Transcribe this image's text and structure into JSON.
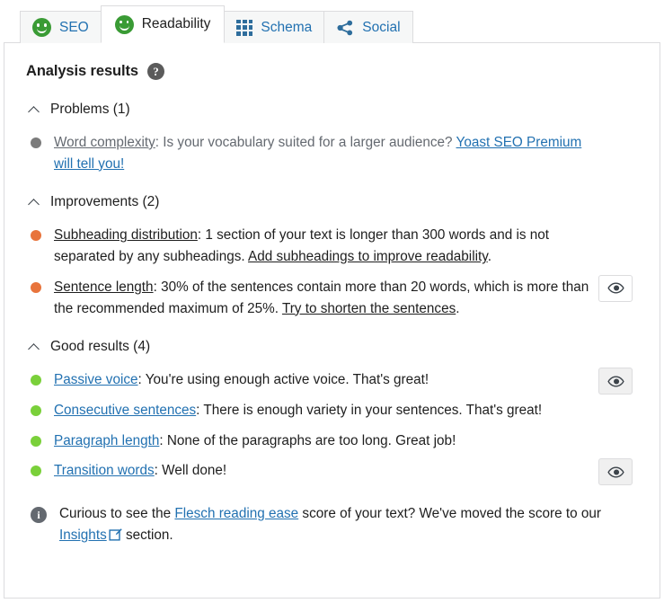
{
  "tabs": [
    {
      "id": "seo",
      "label": "SEO",
      "icon": "smiley-green-icon",
      "active": false
    },
    {
      "id": "readability",
      "label": "Readability",
      "icon": "smiley-green-icon",
      "active": true
    },
    {
      "id": "schema",
      "label": "Schema",
      "icon": "grid-icon",
      "active": false
    },
    {
      "id": "social",
      "label": "Social",
      "icon": "share-icon",
      "active": false
    }
  ],
  "analysis": {
    "title": "Analysis results",
    "help_icon": "question-mark-icon"
  },
  "sections": [
    {
      "id": "problems",
      "title": "Problems (1)",
      "chevron": "chevron-up-icon",
      "items": [
        {
          "id": "word-complexity",
          "bullet_color": "#7b7b7b",
          "state": "muted",
          "title": "Word complexity",
          "body": ": Is your vocabulary suited for a larger audience? ",
          "link_text": "Yoast SEO Premium will tell you!",
          "link_style": "blue",
          "tail": "",
          "eye_button": false
        }
      ]
    },
    {
      "id": "improvements",
      "title": "Improvements (2)",
      "chevron": "chevron-up-icon",
      "items": [
        {
          "id": "subheading-distribution",
          "bullet_color": "#e8743c",
          "state": "improvement",
          "title": "Subheading distribution",
          "body": ": 1 section of your text is longer than 300 words and is not separated by any subheadings. ",
          "link_text": "Add subheadings to improve readability",
          "link_style": "dark",
          "tail": ".",
          "eye_button": false
        },
        {
          "id": "sentence-length",
          "bullet_color": "#e8743c",
          "state": "improvement",
          "title": "Sentence length",
          "body": ": 30% of the sentences contain more than 20 words, which is more than the recommended maximum of 25%. ",
          "link_text": "Try to shorten the sentences",
          "link_style": "dark",
          "tail": ".",
          "eye_button": true,
          "eye_pressed": false,
          "eye_label": "eye-icon"
        }
      ]
    },
    {
      "id": "good-results",
      "title": "Good results (4)",
      "chevron": "chevron-up-icon",
      "items": [
        {
          "id": "passive-voice",
          "bullet_color": "#7ad03a",
          "state": "good",
          "title": "Passive voice",
          "body": ": You're using enough active voice. That's great!",
          "link_text": "",
          "link_style": "none",
          "tail": "",
          "eye_button": true,
          "eye_pressed": true,
          "eye_label": "eye-icon"
        },
        {
          "id": "consecutive-sentences",
          "bullet_color": "#7ad03a",
          "state": "good",
          "title": "Consecutive sentences",
          "body": ": There is enough variety in your sentences. That's great!",
          "link_text": "",
          "link_style": "none",
          "tail": "",
          "eye_button": false
        },
        {
          "id": "paragraph-length",
          "bullet_color": "#7ad03a",
          "state": "good",
          "title": "Paragraph length",
          "body": ": None of the paragraphs are too long. Great job!",
          "link_text": "",
          "link_style": "none",
          "tail": "",
          "eye_button": false
        },
        {
          "id": "transition-words",
          "bullet_color": "#7ad03a",
          "state": "good",
          "title": "Transition words",
          "body": ": Well done!",
          "link_text": "",
          "link_style": "none",
          "tail": "",
          "eye_button": true,
          "eye_pressed": true,
          "eye_label": "eye-icon"
        }
      ]
    }
  ],
  "footer": {
    "icon": "info-icon",
    "lead": "Curious to see the ",
    "link1": "Flesch reading ease",
    "middle": " score of your text? We've moved the score to our ",
    "link2": "Insights",
    "external_icon": "external-link-icon",
    "tail": " section."
  },
  "colors": {
    "link_blue": "#2271b1",
    "icon_blue": "#2e6d9c",
    "good_green": "#7ad03a",
    "smiley_green": "#3a9b35",
    "improvement_orange": "#e8743c",
    "muted_gray": "#7b7b7b",
    "border_gray": "#dcdcde",
    "tab_bg": "#f6f7f7"
  }
}
